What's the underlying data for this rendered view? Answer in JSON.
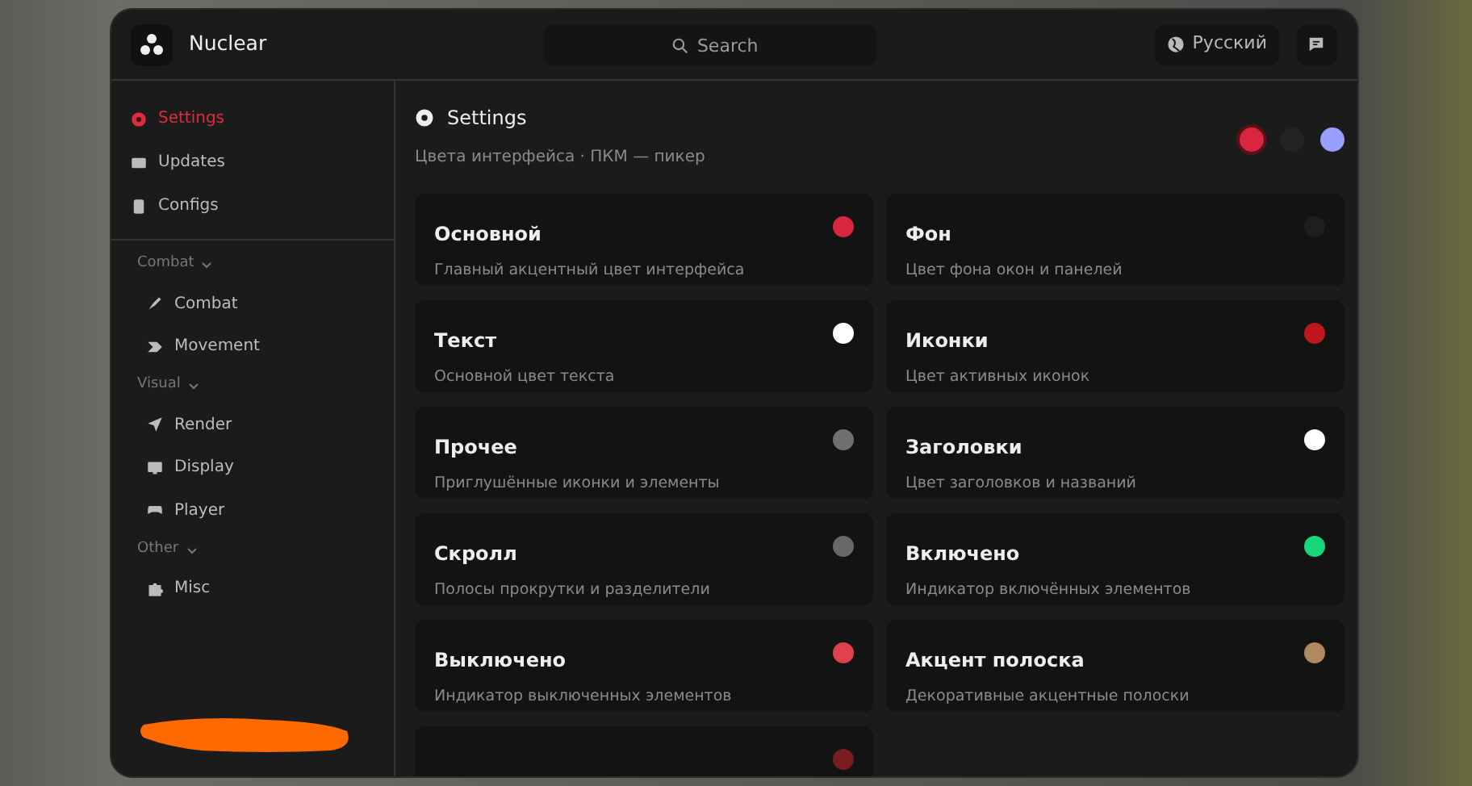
{
  "app": {
    "title": "Nuclear"
  },
  "search": {
    "placeholder": "Search"
  },
  "language": {
    "label": "Русский"
  },
  "sidebar": {
    "items": [
      {
        "label": "Settings",
        "selected": true
      },
      {
        "label": "Updates",
        "selected": false
      },
      {
        "label": "Configs",
        "selected": false
      }
    ],
    "groups": [
      {
        "label": "Combat",
        "expanded": true,
        "children": [
          {
            "label": "Combat",
            "selected": false
          },
          {
            "label": "Movement",
            "selected": false
          }
        ]
      },
      {
        "label": "Visual",
        "expanded": true,
        "children": [
          {
            "label": "Render",
            "selected": false
          },
          {
            "label": "Display",
            "selected": false
          },
          {
            "label": "Player",
            "selected": false
          }
        ]
      },
      {
        "label": "Other",
        "expanded": true,
        "children": [
          {
            "label": "Misc",
            "selected": false
          }
        ]
      }
    ]
  },
  "panel": {
    "title": "Settings",
    "subtitle": "Цвета интерфейса · ПКМ — пикер",
    "presets": [
      {
        "color": "#d7263d",
        "selected": true
      },
      {
        "color": "#232323",
        "selected": false
      },
      {
        "color": "#9aa0ff",
        "selected": false
      }
    ],
    "colors": [
      {
        "title": "Основной",
        "description": "Главный акцентный цвет интерфейса",
        "color": "#d7263d"
      },
      {
        "title": "Фон",
        "description": "Цвет фона окон и панелей",
        "color": "#1e1e1e"
      },
      {
        "title": "Текст",
        "description": "Основной цвет текста",
        "color": "#ffffff"
      },
      {
        "title": "Иконки",
        "description": "Цвет активных иконок",
        "color": "#c0171d"
      },
      {
        "title": "Прочее",
        "description": "Приглушённые иконки и элементы",
        "color": "#707070"
      },
      {
        "title": "Заголовки",
        "description": "Цвет заголовков и названий",
        "color": "#ffffff"
      },
      {
        "title": "Скролл",
        "description": "Полосы прокрутки и разделители",
        "color": "#686868"
      },
      {
        "title": "Включено",
        "description": "Индикатор включённых элементов",
        "color": "#17d67a"
      },
      {
        "title": "Выключено",
        "description": "Индикатор выключенных элементов",
        "color": "#e0404a"
      },
      {
        "title": "Акцент полоска",
        "description": "Декоративные акцентные полоски",
        "color": "#b08a5e"
      },
      {
        "color": "#7a1c22"
      }
    ]
  }
}
